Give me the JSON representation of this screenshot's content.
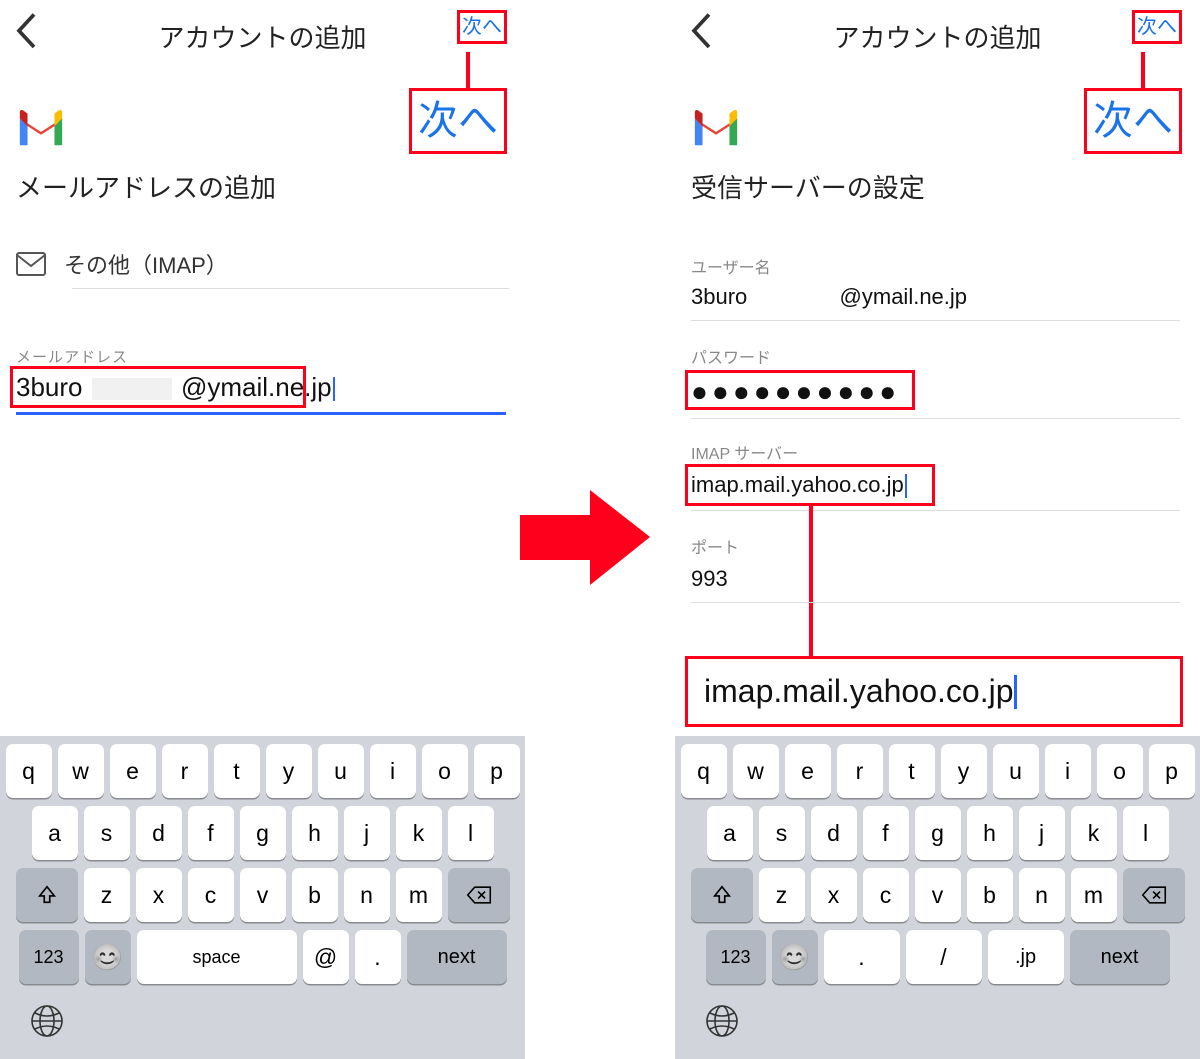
{
  "header": {
    "title": "アカウントの追加",
    "next_small": "次へ",
    "next_big": "次へ"
  },
  "left_screen": {
    "subtitle": "メールアドレスの追加",
    "imap_row": "その他（IMAP）",
    "field_label": "メールアドレス",
    "email_prefix": "3buro",
    "email_suffix": "@ymail.ne.jp"
  },
  "right_screen": {
    "subtitle": "受信サーバーの設定",
    "user_label": "ユーザー名",
    "user_prefix": "3buro",
    "user_suffix": "@ymail.ne.jp",
    "pass_label": "パスワード",
    "pass_masked": "●●●●●●●●●●",
    "imap_label": "IMAP サーバー",
    "imap_value": "imap.mail.yahoo.co.jp",
    "port_label": "ポート",
    "port_value": "993",
    "callout": "imap.mail.yahoo.co.jp"
  },
  "keyboard_alpha": {
    "row1": [
      "q",
      "w",
      "e",
      "r",
      "t",
      "y",
      "u",
      "i",
      "o",
      "p"
    ],
    "row2": [
      "a",
      "s",
      "d",
      "f",
      "g",
      "h",
      "j",
      "k",
      "l"
    ],
    "row3": [
      "z",
      "x",
      "c",
      "v",
      "b",
      "n",
      "m"
    ],
    "num": "123",
    "space": "space",
    "at": "@",
    "dot": ".",
    "next": "next"
  },
  "keyboard_url": {
    "row2": [
      "a",
      "s",
      "d",
      "f",
      "g",
      "h",
      "j",
      "k",
      "l"
    ],
    "row3": [
      "z",
      "x",
      "c",
      "v",
      "b",
      "n",
      "m"
    ],
    "num": "123",
    "dot": ".",
    "slash": "/",
    "jp": ".jp",
    "next": "next"
  }
}
